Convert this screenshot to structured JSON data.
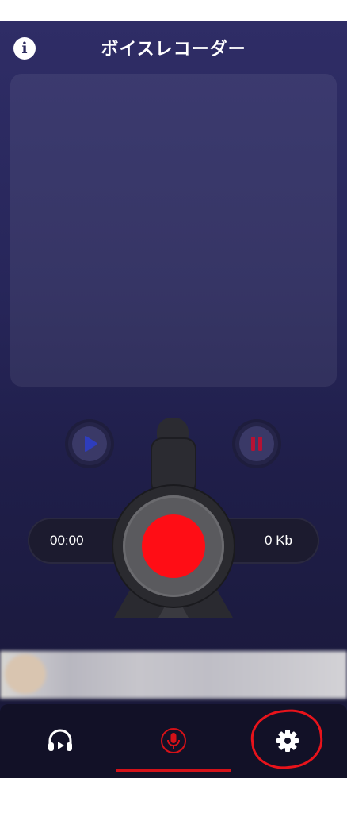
{
  "header": {
    "title": "ボイスレコーダー",
    "info_icon": "info-icon",
    "info_glyph": "i"
  },
  "recorder": {
    "elapsed_time": "00:00",
    "file_size": "0 Kb",
    "play_icon": "play-icon",
    "pause_icon": "pause-icon",
    "record_icon": "record-icon"
  },
  "nav": {
    "items": [
      {
        "icon": "headphones-play-icon",
        "active": false
      },
      {
        "icon": "microphone-icon",
        "active": true
      },
      {
        "icon": "gear-icon",
        "active": false
      }
    ]
  },
  "colors": {
    "background_top": "#2f2d66",
    "background_bottom": "#181734",
    "record_red": "#ff0d15",
    "play_blue": "#2e3dbd",
    "pause_red": "#b51234",
    "highlight_red": "#e8131b",
    "nav_background": "#121127"
  }
}
